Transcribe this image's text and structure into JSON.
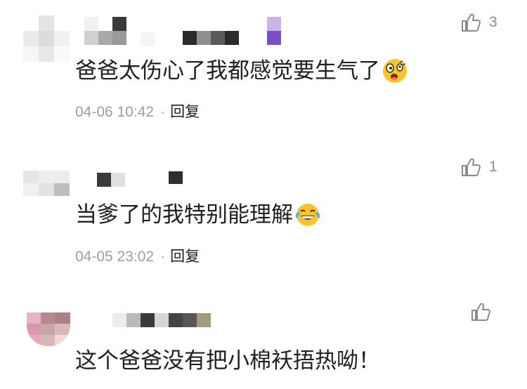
{
  "comments": [
    {
      "likes": "3",
      "content": "爸爸太伤心了我都感觉要生气了",
      "emoji": "shocked-face-emoji",
      "time": "04-06 10:42",
      "separator": "·",
      "reply": "回复"
    },
    {
      "likes": "1",
      "content": "当爹了的我特别能理解",
      "emoji": "tears-of-joy-emoji",
      "time": "04-05 23:02",
      "separator": "·",
      "reply": "回复"
    },
    {
      "likes": "",
      "content": "这个爸爸没有把小棉袄捂热呦！"
    }
  ],
  "icons": {
    "like": "thumbs-up-icon"
  },
  "colors": {
    "text": "#1f1f1f",
    "meta": "#9b9ea3",
    "icon": "#888a8f"
  }
}
